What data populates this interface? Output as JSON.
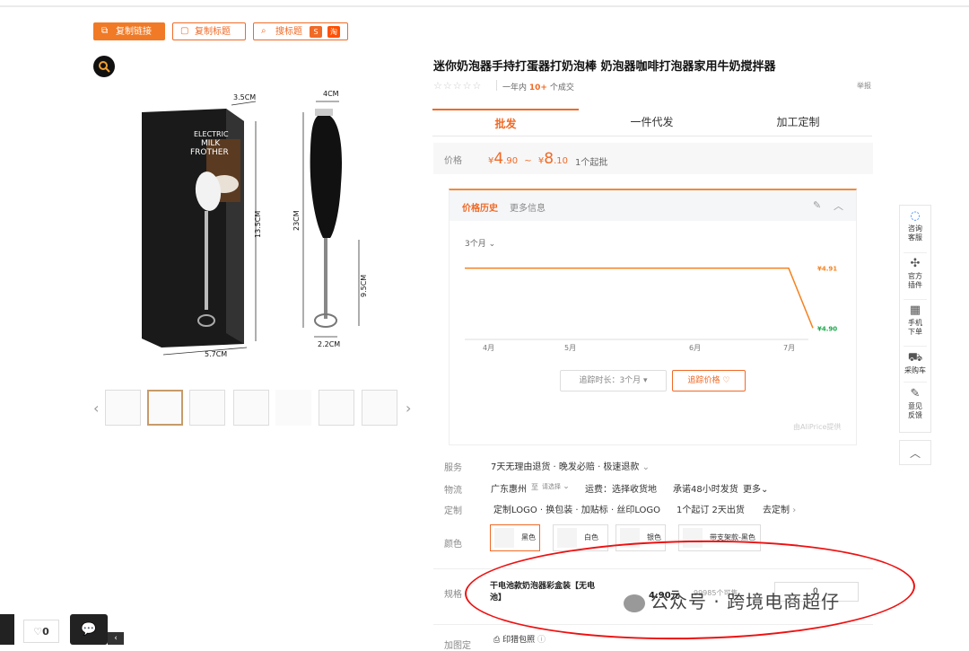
{
  "toolbar": {
    "copy_link": "复制链接",
    "copy_title": "复制标题",
    "search_title": "搜标题",
    "badge1": "S",
    "badge2": "淘"
  },
  "product": {
    "title": "迷你奶泡器手持打蛋器打奶泡棒 奶泡器咖啡打泡器家用牛奶搅拌器",
    "sales_prefix": "一年内",
    "sales_count": "10+",
    "sales_suffix": "个成交",
    "report": "举报"
  },
  "image_labels": {
    "box_brand_1": "ELECTRIC",
    "box_brand_2": "MILK",
    "box_brand_3": "FROTHER",
    "dim_35": "3.5CM",
    "dim_135": "13.5CM",
    "dim_57": "5.7CM",
    "dim_4": "4CM",
    "dim_23": "23CM",
    "dim_95": "9.5CM",
    "dim_22": "2.2CM"
  },
  "tabs": [
    "批发",
    "一件代发",
    "加工定制"
  ],
  "price": {
    "label": "价格",
    "currency": "¥",
    "low_int": "4",
    "low_dec": ".90",
    "sep": "~",
    "high_int": "8",
    "high_dec": ".10",
    "moq": "1个起批"
  },
  "history": {
    "tab_active": "价格历史",
    "tab_more": "更多信息",
    "range": "3个月",
    "months": [
      "4月",
      "5月",
      "6月",
      "7月"
    ],
    "start_price_label": "¥4.91",
    "end_price_label": "¥4.90",
    "track_duration": "追踪时长：3个月",
    "track_button": "追踪价格",
    "provider": "由AliPrice提供"
  },
  "chart_data": {
    "type": "line",
    "x": [
      "4月",
      "5月",
      "6月",
      "7月"
    ],
    "series": [
      {
        "values": [
          4.91,
          4.91,
          4.91,
          4.91,
          4.9
        ]
      }
    ],
    "annotations": [
      "¥4.91",
      "¥4.90"
    ]
  },
  "sidebar": [
    {
      "l1": "咨询",
      "l2": "客服"
    },
    {
      "l1": "官方",
      "l2": "插件"
    },
    {
      "l1": "手机",
      "l2": "下单"
    },
    {
      "l1": "采购车",
      "l2": ""
    },
    {
      "l1": "意见",
      "l2": "反馈"
    }
  ],
  "service": {
    "label": "服务",
    "text": "7天无理由退货 · 晚发必赔 · 极速退款"
  },
  "logistics": {
    "label": "物流",
    "origin": "广东惠州",
    "to": "至",
    "choose": "请选择",
    "freight": "运费：选择收货地",
    "promise": "承诺48小时发货",
    "more": "更多"
  },
  "custom": {
    "label": "定制",
    "text": "定制LOGO · 换包装 · 加贴标 · 丝印LOGO",
    "moq": "1个起订 2天出货",
    "go": "去定制"
  },
  "colors": {
    "label": "颜色",
    "options": [
      "黑色",
      "白色",
      "银色",
      "带支架款-黑色"
    ]
  },
  "spec": {
    "label": "规格",
    "name_line1": "干电池款奶泡器彩盒装【无电",
    "name_line2": "池】",
    "price": "4.90元",
    "stock": "99985个可售",
    "qty": "0"
  },
  "extra": {
    "label": "加图定",
    "text": "印猎包照"
  },
  "watermark": "公众号 · 跨境电商超仔",
  "bottom": {
    "fav_count": "0"
  }
}
